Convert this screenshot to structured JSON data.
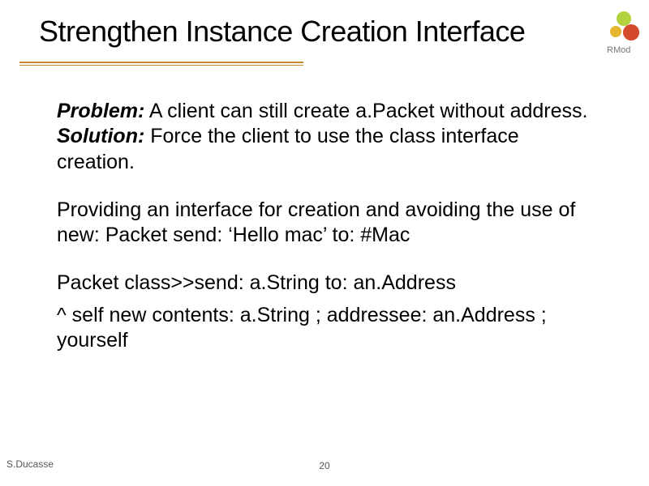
{
  "title": "Strengthen Instance Creation Interface",
  "logo_label": "RMod",
  "labels": {
    "problem": "Problem:",
    "solution": "Solution:"
  },
  "body": {
    "problem_text": " A client can still create a.Packet without address.",
    "solution_text": " Force the client to use the class interface creation.",
    "para2": "Providing an interface for creation and avoiding the use of new:  Packet send: ‘Hello mac’ to: #Mac",
    "signature": "Packet class>>send: a.String to: an.Address",
    "code": "^ self new contents: a.String ; addressee: an.Address ; yourself"
  },
  "footer": {
    "author": "S.Ducasse",
    "page": "20"
  }
}
